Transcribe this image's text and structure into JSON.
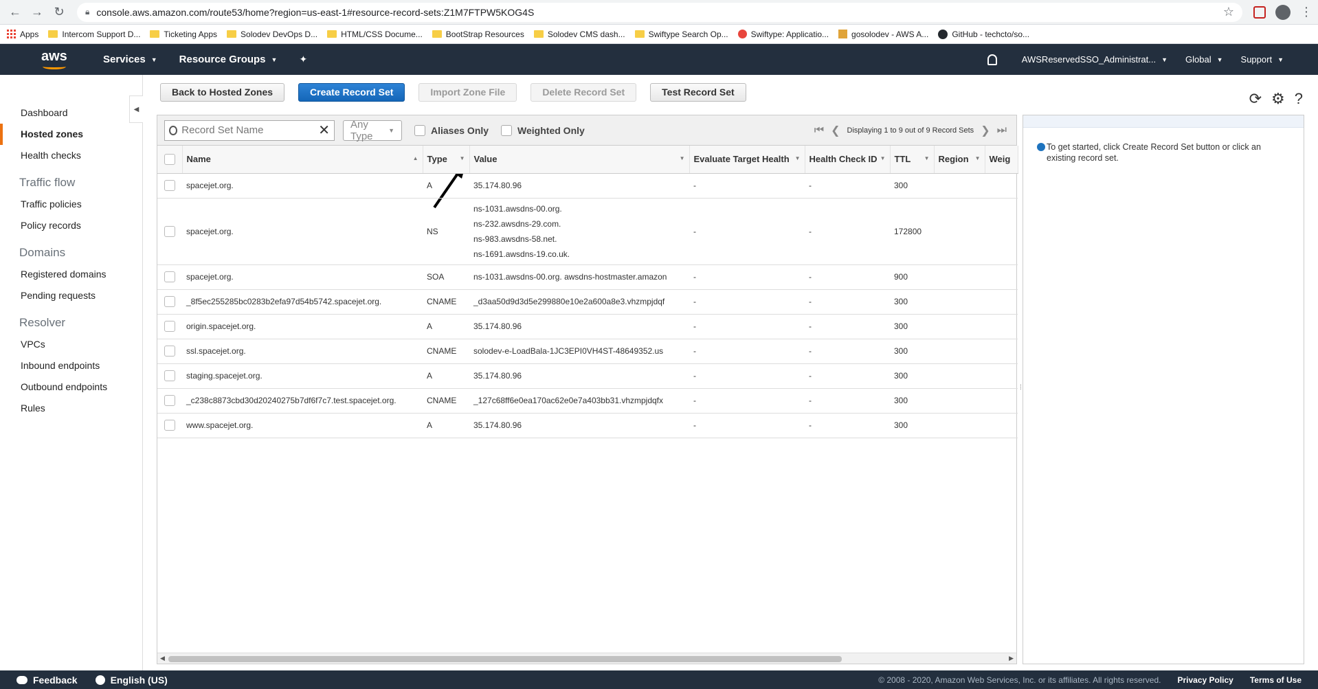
{
  "browser": {
    "url": "console.aws.amazon.com/route53/home?region=us-east-1#resource-record-sets:Z1M7FTPW5KOG4S",
    "bookmarks": [
      "Apps",
      "Intercom Support D...",
      "Ticketing Apps",
      "Solodev DevOps D...",
      "HTML/CSS Docume...",
      "BootStrap Resources",
      "Solodev CMS dash...",
      "Swiftype Search Op...",
      "Swiftype: Applicatio...",
      "gosolodev - AWS A...",
      "GitHub - techcto/so..."
    ]
  },
  "awsnav": {
    "logo": "aws",
    "services": "Services",
    "resource_groups": "Resource Groups",
    "account": "AWSReservedSSO_Administrat...",
    "region": "Global",
    "support": "Support"
  },
  "sidebar": {
    "items": [
      "Dashboard",
      "Hosted zones",
      "Health checks"
    ],
    "traffic_flow": {
      "heading": "Traffic flow",
      "items": [
        "Traffic policies",
        "Policy records"
      ]
    },
    "domains": {
      "heading": "Domains",
      "items": [
        "Registered domains",
        "Pending requests"
      ]
    },
    "resolver": {
      "heading": "Resolver",
      "items": [
        "VPCs",
        "Inbound endpoints",
        "Outbound endpoints",
        "Rules"
      ]
    }
  },
  "toolbar": {
    "back": "Back to Hosted Zones",
    "create": "Create Record Set",
    "import": "Import Zone File",
    "delete": "Delete Record Set",
    "test": "Test Record Set"
  },
  "filter": {
    "search_placeholder": "Record Set Name",
    "type_select": "Any Type",
    "aliases_only": "Aliases Only",
    "weighted_only": "Weighted Only",
    "pager_text": "Displaying 1 to 9 out of 9 Record Sets"
  },
  "table": {
    "columns": [
      "Name",
      "Type",
      "Value",
      "Evaluate Target Health",
      "Health Check ID",
      "TTL",
      "Region",
      "Weig"
    ],
    "rows": [
      {
        "name": "spacejet.org.",
        "type": "A",
        "values": [
          "35.174.80.96"
        ],
        "eth": "-",
        "hcid": "-",
        "ttl": "300"
      },
      {
        "name": "spacejet.org.",
        "type": "NS",
        "values": [
          "ns-1031.awsdns-00.org.",
          "ns-232.awsdns-29.com.",
          "ns-983.awsdns-58.net.",
          "ns-1691.awsdns-19.co.uk."
        ],
        "eth": "-",
        "hcid": "-",
        "ttl": "172800"
      },
      {
        "name": "spacejet.org.",
        "type": "SOA",
        "values": [
          "ns-1031.awsdns-00.org. awsdns-hostmaster.amazon"
        ],
        "eth": "-",
        "hcid": "-",
        "ttl": "900"
      },
      {
        "name": "_8f5ec255285bc0283b2efa97d54b5742.spacejet.org.",
        "type": "CNAME",
        "values": [
          "_d3aa50d9d3d5e299880e10e2a600a8e3.vhzmpjdqf"
        ],
        "eth": "-",
        "hcid": "-",
        "ttl": "300"
      },
      {
        "name": "origin.spacejet.org.",
        "type": "A",
        "values": [
          "35.174.80.96"
        ],
        "eth": "-",
        "hcid": "-",
        "ttl": "300"
      },
      {
        "name": "ssl.spacejet.org.",
        "type": "CNAME",
        "values": [
          "solodev-e-LoadBala-1JC3EPI0VH4ST-48649352.us"
        ],
        "eth": "-",
        "hcid": "-",
        "ttl": "300"
      },
      {
        "name": "staging.spacejet.org.",
        "type": "A",
        "values": [
          "35.174.80.96"
        ],
        "eth": "-",
        "hcid": "-",
        "ttl": "300"
      },
      {
        "name": "_c238c8873cbd30d20240275b7df6f7c7.test.spacejet.org.",
        "type": "CNAME",
        "values": [
          "_127c68ff6e0ea170ac62e0e7a403bb31.vhzmpjdqfx"
        ],
        "eth": "-",
        "hcid": "-",
        "ttl": "300"
      },
      {
        "name": "www.spacejet.org.",
        "type": "A",
        "values": [
          "35.174.80.96"
        ],
        "eth": "-",
        "hcid": "-",
        "ttl": "300"
      }
    ]
  },
  "detail": {
    "hint": "To get started, click Create Record Set button or click an existing record set."
  },
  "footer": {
    "feedback": "Feedback",
    "language": "English (US)",
    "copyright": "© 2008 - 2020, Amazon Web Services, Inc. or its affiliates. All rights reserved.",
    "privacy": "Privacy Policy",
    "terms": "Terms of Use"
  },
  "colors": {
    "aws_nav": "#232f3e",
    "aws_orange": "#ff9900",
    "active_marker": "#ec7211",
    "primary_button": "#1466b8"
  }
}
